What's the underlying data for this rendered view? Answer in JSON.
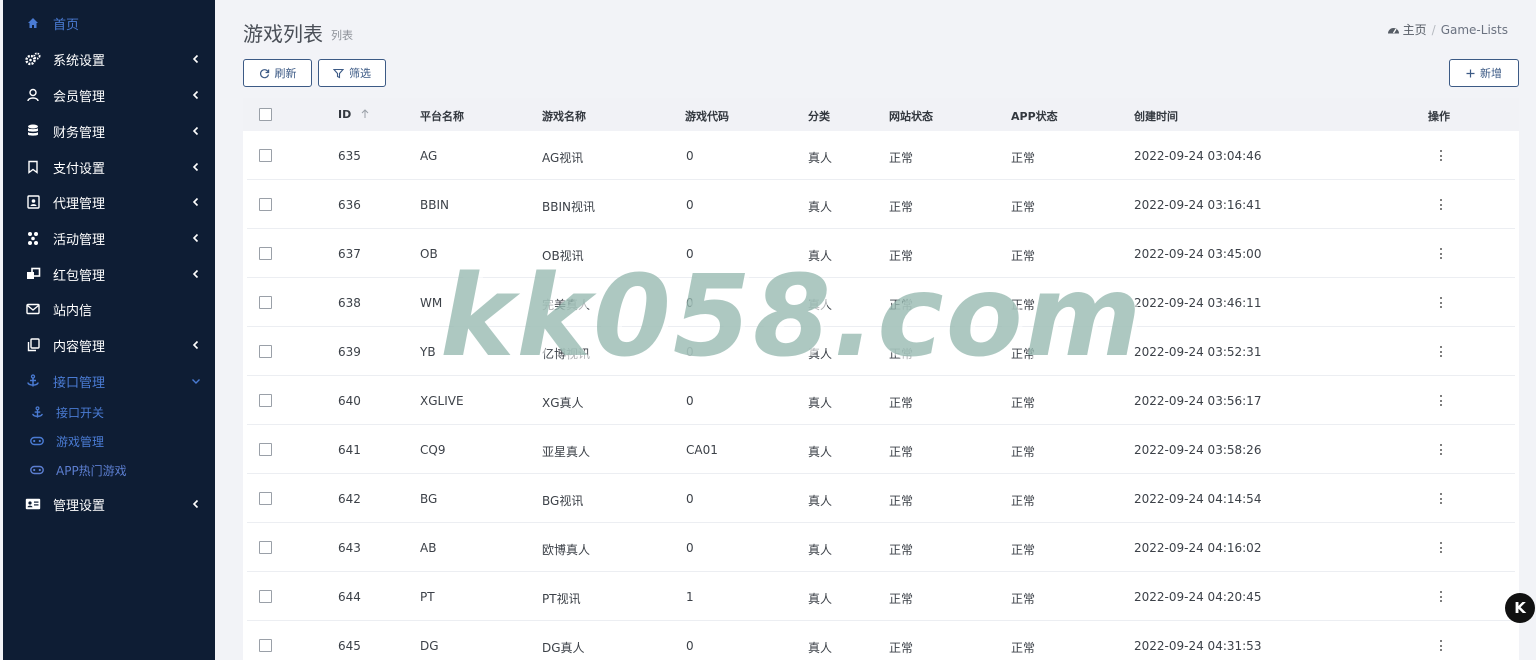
{
  "sidebar": {
    "items": [
      {
        "label": "首页",
        "icon": "home-icon"
      },
      {
        "label": "系统设置",
        "icon": "cogs-icon"
      },
      {
        "label": "会员管理",
        "icon": "user-icon"
      },
      {
        "label": "财务管理",
        "icon": "database-icon"
      },
      {
        "label": "支付设置",
        "icon": "bookmark-icon"
      },
      {
        "label": "代理管理",
        "icon": "portrait-icon"
      },
      {
        "label": "活动管理",
        "icon": "network-icon"
      },
      {
        "label": "红包管理",
        "icon": "clone-icon"
      },
      {
        "label": "站内信",
        "icon": "envelope-icon"
      },
      {
        "label": "内容管理",
        "icon": "copy-icon"
      },
      {
        "label": "接口管理",
        "icon": "anchor-icon"
      },
      {
        "label": "接口开关",
        "icon": "anchor-icon"
      },
      {
        "label": "游戏管理",
        "icon": "gamepad-icon"
      },
      {
        "label": "APP热门游戏",
        "icon": "gamepad-icon"
      },
      {
        "label": "管理设置",
        "icon": "id-card-icon"
      }
    ]
  },
  "header": {
    "title": "游戏列表",
    "subtitle": "列表",
    "breadcrumb": {
      "home": "主页",
      "current": "Game-Lists"
    }
  },
  "toolbar": {
    "refresh_label": "刷新",
    "filter_label": "筛选",
    "add_label": "新增"
  },
  "table": {
    "columns": [
      "ID",
      "平台名称",
      "游戏名称",
      "游戏代码",
      "分类",
      "网站状态",
      "APP状态",
      "创建时间",
      "操作"
    ],
    "rows": [
      {
        "id": "635",
        "platform": "AG",
        "game": "AG视讯",
        "code": "0",
        "category": "真人",
        "web_status": "正常",
        "app_status": "正常",
        "created": "2022-09-24 03:04:46"
      },
      {
        "id": "636",
        "platform": "BBIN",
        "game": "BBIN视讯",
        "code": "0",
        "category": "真人",
        "web_status": "正常",
        "app_status": "正常",
        "created": "2022-09-24 03:16:41"
      },
      {
        "id": "637",
        "platform": "OB",
        "game": "OB视讯",
        "code": "0",
        "category": "真人",
        "web_status": "正常",
        "app_status": "正常",
        "created": "2022-09-24 03:45:00"
      },
      {
        "id": "638",
        "platform": "WM",
        "game": "完美真人",
        "code": "0",
        "category": "真人",
        "web_status": "正常",
        "app_status": "正常",
        "created": "2022-09-24 03:46:11"
      },
      {
        "id": "639",
        "platform": "YB",
        "game": "亿博视讯",
        "code": "0",
        "category": "真人",
        "web_status": "正常",
        "app_status": "正常",
        "created": "2022-09-24 03:52:31"
      },
      {
        "id": "640",
        "platform": "XGLIVE",
        "game": "XG真人",
        "code": "0",
        "category": "真人",
        "web_status": "正常",
        "app_status": "正常",
        "created": "2022-09-24 03:56:17"
      },
      {
        "id": "641",
        "platform": "CQ9",
        "game": "亚星真人",
        "code": "CA01",
        "category": "真人",
        "web_status": "正常",
        "app_status": "正常",
        "created": "2022-09-24 03:58:26"
      },
      {
        "id": "642",
        "platform": "BG",
        "game": "BG视讯",
        "code": "0",
        "category": "真人",
        "web_status": "正常",
        "app_status": "正常",
        "created": "2022-09-24 04:14:54"
      },
      {
        "id": "643",
        "platform": "AB",
        "game": "欧博真人",
        "code": "0",
        "category": "真人",
        "web_status": "正常",
        "app_status": "正常",
        "created": "2022-09-24 04:16:02"
      },
      {
        "id": "644",
        "platform": "PT",
        "game": "PT视讯",
        "code": "1",
        "category": "真人",
        "web_status": "正常",
        "app_status": "正常",
        "created": "2022-09-24 04:20:45"
      },
      {
        "id": "645",
        "platform": "DG",
        "game": "DG真人",
        "code": "0",
        "category": "真人",
        "web_status": "正常",
        "app_status": "正常",
        "created": "2022-09-24 04:31:53"
      }
    ]
  },
  "watermark": "kk058.com",
  "float_badge": "K",
  "colors": {
    "sidebar_bg": "#0e1d34",
    "accent": "#4a7bd3",
    "button_border": "#3c5a85"
  }
}
